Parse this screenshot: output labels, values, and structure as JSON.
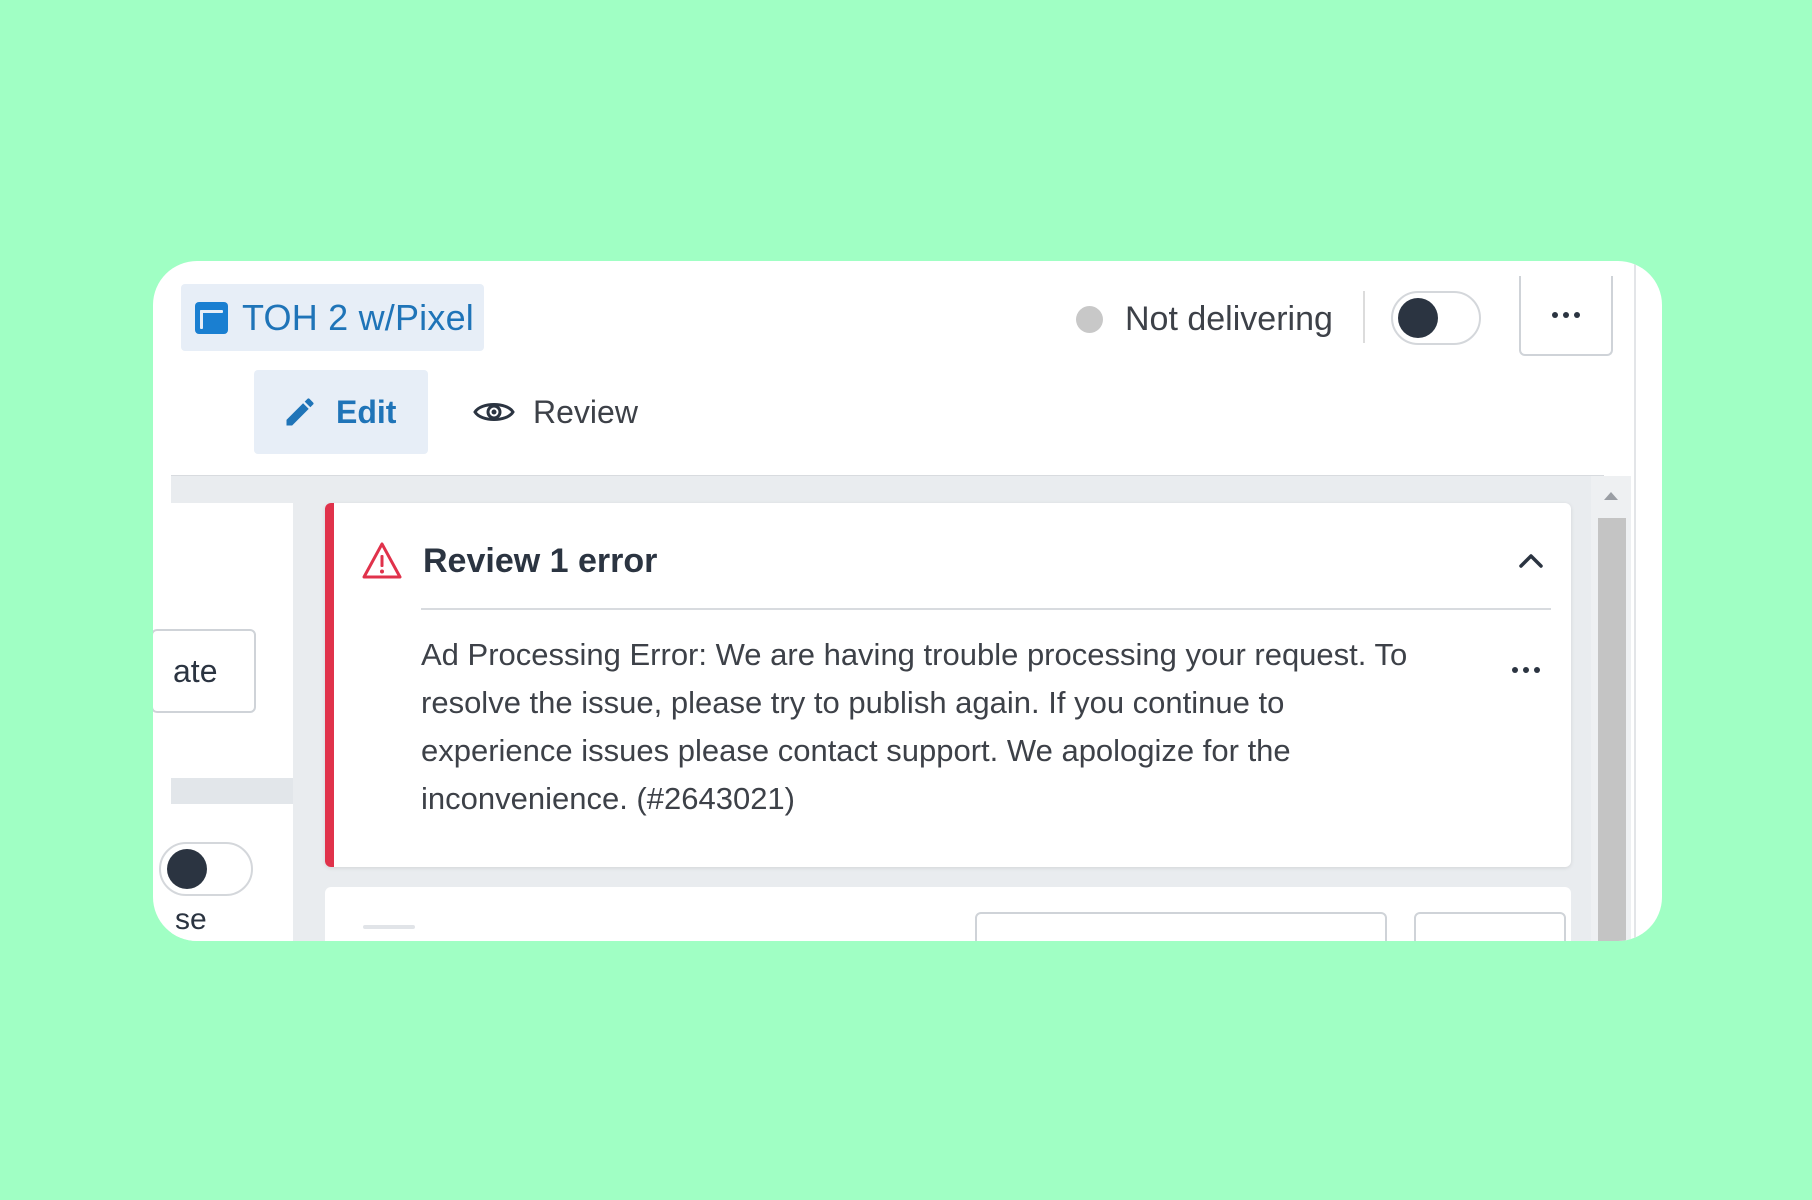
{
  "header": {
    "title": "TOH 2 w/Pixel",
    "status_text": "Not delivering",
    "status_color": "#c8c8c8",
    "delivery_toggle_on": false,
    "more_icon": "ellipsis-icon"
  },
  "tabs": [
    {
      "label": "Edit",
      "icon": "pencil-icon",
      "active": true
    },
    {
      "label": "Review",
      "icon": "eye-icon",
      "active": false
    }
  ],
  "left_panel": {
    "button_label": "ate",
    "toggle_on": false,
    "label": "se"
  },
  "error_panel": {
    "title": "Review 1 error",
    "icon": "warning-icon",
    "collapse_icon": "chevron-up-icon",
    "accent_color": "#e0324b",
    "message": "Ad Processing Error: We are having trouble processing your request. To resolve the issue, please try to publish again. If you continue to experience issues please contact support. We apologize for the inconvenience. (#2643021)"
  },
  "colors": {
    "background": "#a0ffc4",
    "link_blue": "#1f74b8",
    "icon_blue": "#1a7fd1",
    "text_dark": "#2b3441"
  }
}
